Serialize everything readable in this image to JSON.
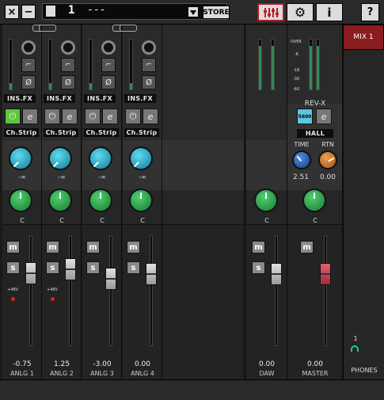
{
  "toolbar": {
    "close_icon": "×",
    "minimize_icon": "−",
    "scene_number": "1",
    "scene_name": "---",
    "store_label": "STORE",
    "help_label": "?",
    "info_label": "i"
  },
  "channels": [
    {
      "id": "anlg1",
      "name": "ANLG 1",
      "pan": "C",
      "gain": "-∞",
      "volume": "-0.75",
      "phantom": "+48V",
      "insfx": "INS.FX",
      "chstrip": "Ch.Strip",
      "stereo_link": true,
      "has_phantom": true,
      "fader_level": 0.7
    },
    {
      "id": "anlg2",
      "name": "ANLG 2",
      "pan": "C",
      "gain": "-∞",
      "volume": "1.25",
      "phantom": "+48V",
      "insfx": "INS.FX",
      "chstrip": "Ch.Strip",
      "stereo_link": true,
      "has_phantom": true,
      "fader_level": 0.74
    },
    {
      "id": "anlg3",
      "name": "ANLG 3",
      "pan": "C",
      "gain": "-∞",
      "volume": "-3.00",
      "phantom": "",
      "insfx": "INS.FX",
      "chstrip": "Ch.Strip",
      "stereo_link": true,
      "has_phantom": false,
      "fader_level": 0.63
    },
    {
      "id": "anlg4",
      "name": "ANLG 4",
      "pan": "C",
      "gain": "-∞",
      "volume": "0.00",
      "phantom": "",
      "insfx": "INS.FX",
      "chstrip": "Ch.Strip",
      "stereo_link": true,
      "has_phantom": false,
      "fader_level": 0.69
    }
  ],
  "daw": {
    "name": "DAW",
    "pan": "C",
    "volume": "0.00",
    "fader_level": 0.69
  },
  "master": {
    "name": "MASTER",
    "pan": "C",
    "volume": "0.00",
    "fader_level": 0.69,
    "meter_labels": [
      "OVER",
      "-6",
      "-18",
      "-30",
      "-60"
    ],
    "reverb_type": "REV-X",
    "reverb_preset": "HALL",
    "reverb_btn": "5600",
    "time_label": "TIME",
    "rtn_label": "RTN",
    "time_value": "2.51",
    "rtn_value": "0.00"
  },
  "mix_tab": "MIX 1",
  "phones": {
    "label": "PHONES",
    "number": "1"
  },
  "labels": {
    "mute": "m",
    "solo": "s",
    "edit": "e"
  },
  "colors": {
    "accent_red": "#8b1c1f",
    "knob_cyan": "#1fa3c7",
    "knob_green": "#2fa84f",
    "knob_blue": "#1f5fb7",
    "knob_orange": "#d9781c"
  }
}
